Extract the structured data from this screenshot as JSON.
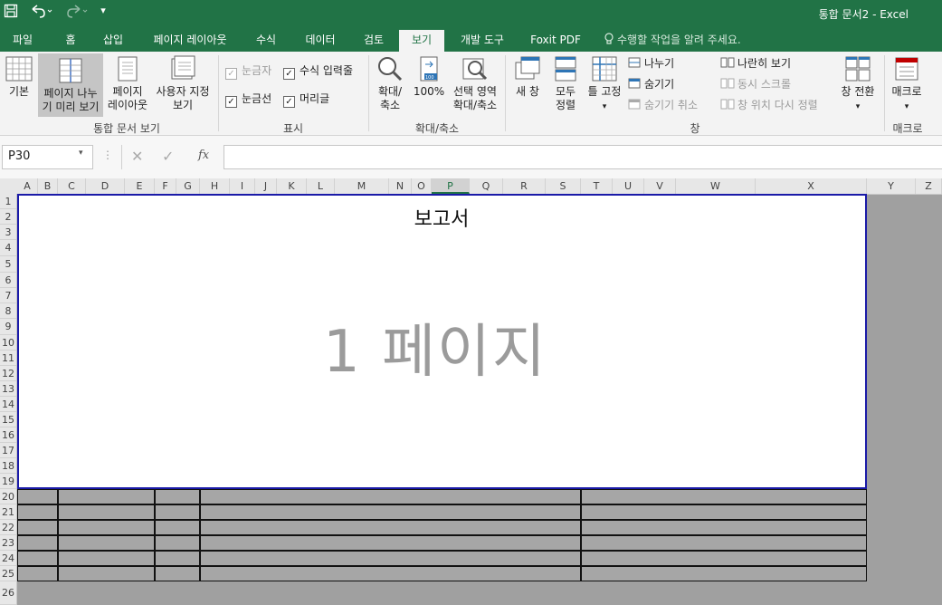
{
  "window": {
    "title": "통합 문서2 - Excel"
  },
  "qat": {
    "save_icon": "save-icon",
    "undo_icon": "undo-icon",
    "redo_icon": "redo-icon",
    "customize": "▾"
  },
  "tabs": [
    {
      "label": "파일"
    },
    {
      "label": "홈"
    },
    {
      "label": "삽입"
    },
    {
      "label": "페이지 레이아웃"
    },
    {
      "label": "수식"
    },
    {
      "label": "데이터"
    },
    {
      "label": "검토"
    },
    {
      "label": "보기"
    },
    {
      "label": "개발 도구"
    },
    {
      "label": "Foxit PDF"
    }
  ],
  "tellme": "수행할 작업을 알려 주세요.",
  "ribbon": {
    "workbook_views": {
      "group": "통합 문서 보기",
      "normal": "기본",
      "page_break_1": "페이지 나누",
      "page_break_2": "기 미리 보기",
      "page_layout_1": "페이지",
      "page_layout_2": "레이아웃",
      "custom_1": "사용자 지정",
      "custom_2": "보기"
    },
    "show": {
      "group": "표시",
      "ruler": "눈금자",
      "formula_bar": "수식 입력줄",
      "gridlines": "눈금선",
      "headings": "머리글"
    },
    "zoom": {
      "group": "확대/축소",
      "zoom_1": "확대/",
      "zoom_2": "축소",
      "hundred": "100%",
      "selection_1": "선택 영역",
      "selection_2": "확대/축소"
    },
    "window": {
      "group": "창",
      "new_window": "새 창",
      "arrange_1": "모두",
      "arrange_2": "정렬",
      "freeze": "틀 고정",
      "split": "나누기",
      "hide": "숨기기",
      "unhide": "숨기기 취소",
      "side_by_side": "나란히 보기",
      "sync_scroll": "동시 스크롤",
      "reset_pos": "창 위치 다시 정렬",
      "switch": "창 전환"
    },
    "macros": {
      "group": "매크로",
      "label": "매크로"
    }
  },
  "formula_bar": {
    "name_box": "P30",
    "fx": "fx",
    "value": ""
  },
  "columns": [
    "A",
    "B",
    "C",
    "D",
    "E",
    "F",
    "G",
    "H",
    "I",
    "J",
    "K",
    "L",
    "M",
    "N",
    "O",
    "P",
    "Q",
    "R",
    "S",
    "T",
    "U",
    "V",
    "W",
    "X",
    "Y",
    "Z"
  ],
  "rows": [
    "1",
    "2",
    "3",
    "4",
    "5",
    "6",
    "7",
    "8",
    "9",
    "10",
    "11",
    "12",
    "13",
    "14",
    "15",
    "16",
    "17",
    "18",
    "19",
    "20",
    "21",
    "22",
    "23",
    "24",
    "25",
    "26"
  ],
  "sheet": {
    "report_title": "보고서",
    "watermark": "1 페이지"
  },
  "colors": {
    "brand": "#217346",
    "page_border": "#1a1aa8",
    "yellow_light": "#fffccc",
    "yellow": "#ffe699",
    "green": "#c6efce"
  }
}
